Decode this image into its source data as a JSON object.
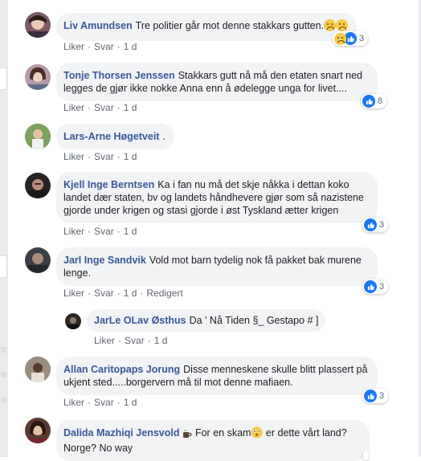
{
  "actions": {
    "like": "Liker",
    "reply": "Svar",
    "dot": "·",
    "edited": "Redigert"
  },
  "comments": [
    {
      "author": "Liv Amundsen",
      "text": "Tre politier går mot denne stakkars gutten.",
      "time": "1 d",
      "reaction_count": "3"
    },
    {
      "author": "Tonje Thorsen Jenssen",
      "text": "Stakkars gutt nå må den etaten snart ned legges de gjør ikke nokke Anna enn å ødelegge unga for livet....",
      "time": "1 d",
      "reaction_count": "8"
    },
    {
      "author": "Lars-Arne Høgetveit",
      "text": ".",
      "time": "1 d"
    },
    {
      "author": "Kjell Inge Berntsen",
      "text": "Ka i fan nu må det skje nåkka i dettan koko landet dær staten, bv og landets håndhevere gjør som så nazistene gjorde under krigen og stasi gjorde i øst Tyskland ætter krigen",
      "time": "1 d",
      "reaction_count": "3"
    },
    {
      "author": "Jarl Inge Sandvik",
      "text": "Vold mot barn tydelig nok få pakket bak murene lenge.",
      "time": "1 d",
      "reaction_count": "3"
    },
    {
      "author": "JarLe OLav Østhus",
      "text": "Da ' Nå Tiden §_ Gestapo # ]",
      "time": "1 d"
    },
    {
      "author": "Allan Caritopaps Jorung",
      "text": "Disse menneskene skulle blitt plassert på ukjent sted.....borgervern må til mot denne mafiaen.",
      "time": "1 d",
      "reaction_count": "3"
    },
    {
      "author": "Dalida Mazhiqi Jensvold",
      "text_a": "For en skam",
      "text_b": "er dette vårt land? Norge? No way"
    }
  ],
  "colors": {
    "link": "#385898",
    "bubble": "#f2f3f5",
    "like": "#1877f2",
    "muted": "#606770"
  }
}
